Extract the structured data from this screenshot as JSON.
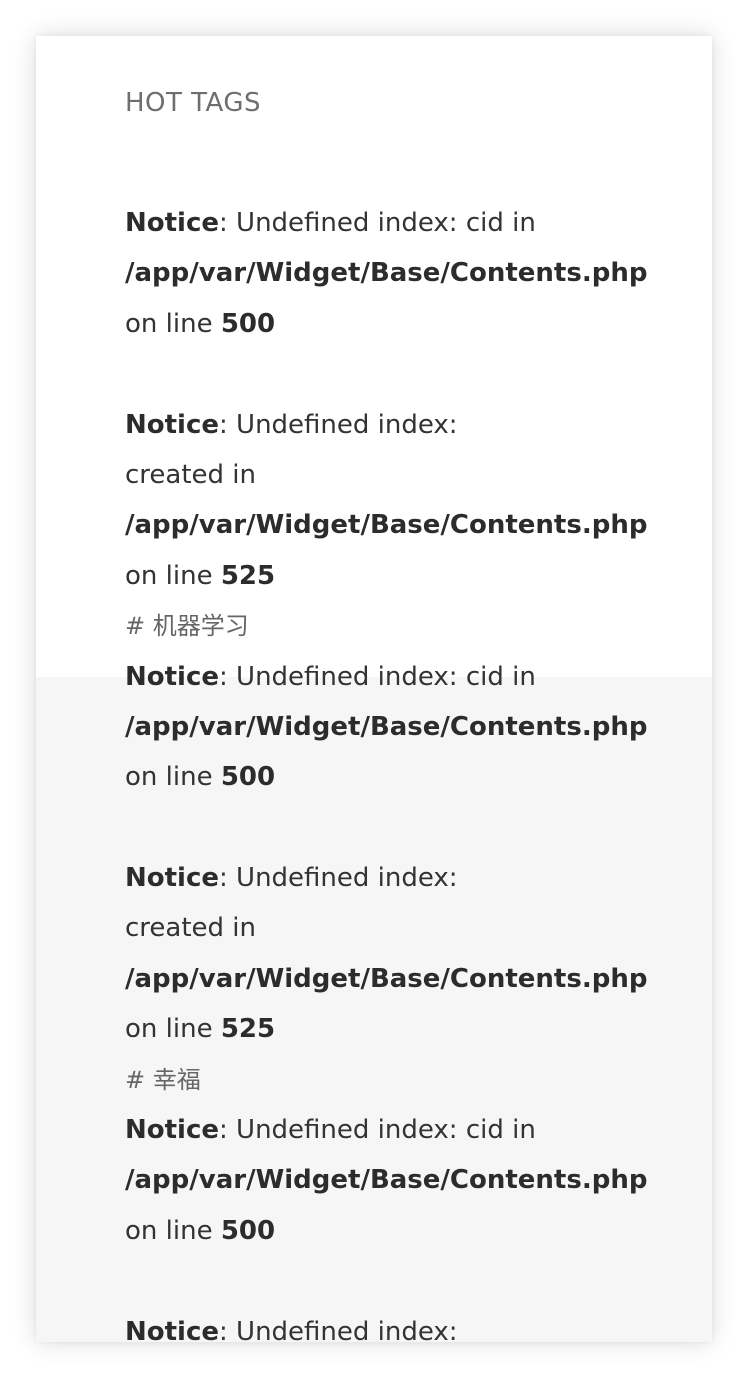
{
  "widget": {
    "title": "HOT TAGS"
  },
  "notices": {
    "notice_label": "Notice",
    "cid_msg": ": Undefined index: cid in",
    "created_msg": ": Undefined index:",
    "created_cont": "created in",
    "file_path": "/app/var/Widget/Base/Contents.php",
    "on_line": "on line ",
    "line_500": "500",
    "line_525": "525"
  },
  "tags": [
    {
      "label": "# 机器学习"
    },
    {
      "label": "# 幸福"
    }
  ]
}
